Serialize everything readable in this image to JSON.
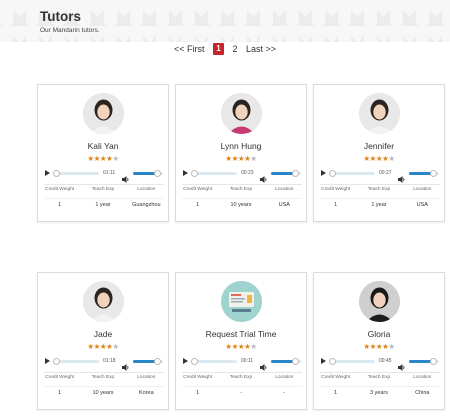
{
  "header": {
    "title": "Tutors",
    "subtitle": "Our Mandarin tutors."
  },
  "pager": {
    "first": "<< First",
    "current": "1",
    "next_page": "2",
    "last": "Last >>"
  },
  "stat_labels": {
    "credit_weight": "Credit Weight",
    "teach_exp": "Teach Exp",
    "location": "Location"
  },
  "tutors": [
    {
      "name": "Kali Yan",
      "rating": 4,
      "max_rating": 5,
      "duration": "01:11",
      "volume": 0.8,
      "credit_weight": "1",
      "teach_exp": "1 year",
      "location": "Guangzhou",
      "avatar": "portrait-photo"
    },
    {
      "name": "Lynn Hung",
      "rating": 4,
      "max_rating": 5,
      "duration": "00:23",
      "volume": 0.8,
      "credit_weight": "1",
      "teach_exp": "10 years",
      "location": "USA",
      "avatar": "portrait-photo"
    },
    {
      "name": "Jennifer",
      "rating": 4,
      "max_rating": 5,
      "duration": "00:27",
      "volume": 0.8,
      "credit_weight": "1",
      "teach_exp": "1 year",
      "location": "USA",
      "avatar": "portrait-photo"
    },
    {
      "name": "Jade",
      "rating": 4,
      "max_rating": 5,
      "duration": "01:18",
      "volume": 0.8,
      "credit_weight": "1",
      "teach_exp": "10 years",
      "location": "Korea",
      "avatar": "portrait-photo"
    },
    {
      "name": "Request Trial Time",
      "rating": 4,
      "max_rating": 5,
      "duration": "00:11",
      "volume": 0.8,
      "credit_weight": "1",
      "teach_exp": "-",
      "location": "-",
      "avatar": "classroom-illustration"
    },
    {
      "name": "Gloria",
      "rating": 4,
      "max_rating": 5,
      "duration": "00:45",
      "volume": 0.8,
      "credit_weight": "1",
      "teach_exp": "3 years",
      "location": "China",
      "avatar": "portrait-photo"
    }
  ],
  "colors": {
    "accent": "#c7252b",
    "star": "#e0821a",
    "volume": "#2b86c8"
  }
}
